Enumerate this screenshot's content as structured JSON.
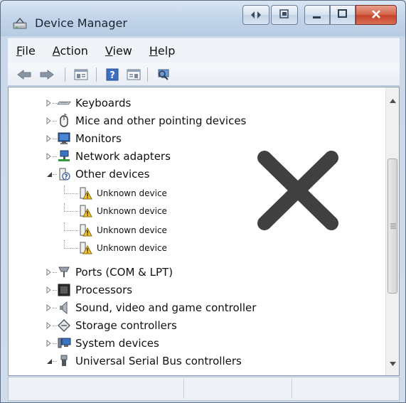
{
  "window": {
    "title": "Device Manager"
  },
  "titlebar_buttons": [
    {
      "name": "back-forward-icon"
    },
    {
      "name": "restore-window-icon"
    },
    {
      "name": "minimize-icon"
    },
    {
      "name": "maximize-icon"
    },
    {
      "name": "close-icon"
    }
  ],
  "menu": [
    {
      "accel": "F",
      "rest": "ile"
    },
    {
      "accel": "A",
      "rest": "ction"
    },
    {
      "accel": "V",
      "rest": "iew"
    },
    {
      "accel": "H",
      "rest": "elp"
    }
  ],
  "toolbar": [
    "back-icon",
    "forward-icon",
    "properties-icon",
    "help-icon",
    "update-driver-icon",
    "scan-hardware-icon"
  ],
  "tree": [
    {
      "label": "Keyboards",
      "icon": "keyboard-icon",
      "expanded": false,
      "level": 0
    },
    {
      "label": "Mice and other pointing devices",
      "icon": "mouse-icon",
      "expanded": false,
      "level": 0
    },
    {
      "label": "Monitors",
      "icon": "monitor-icon",
      "expanded": false,
      "level": 0
    },
    {
      "label": "Network adapters",
      "icon": "network-icon",
      "expanded": false,
      "level": 0
    },
    {
      "label": "Other devices",
      "icon": "unknown-device-category-icon",
      "expanded": true,
      "level": 0
    },
    {
      "label": "Unknown device",
      "icon": "unknown-device-warning-icon",
      "level": 1
    },
    {
      "label": "Unknown device",
      "icon": "unknown-device-warning-icon",
      "level": 1
    },
    {
      "label": "Unknown device",
      "icon": "unknown-device-warning-icon",
      "level": 1
    },
    {
      "label": "Unknown device",
      "icon": "unknown-device-warning-icon",
      "level": 1
    },
    {
      "label": "Ports (COM & LPT)",
      "icon": "port-icon",
      "expanded": false,
      "level": 0
    },
    {
      "label": "Processors",
      "icon": "processor-icon",
      "expanded": false,
      "level": 0
    },
    {
      "label": "Sound, video and game controller",
      "icon": "speaker-icon",
      "expanded": false,
      "level": 0
    },
    {
      "label": "Storage controllers",
      "icon": "storage-icon",
      "expanded": false,
      "level": 0
    },
    {
      "label": "System devices",
      "icon": "system-icon",
      "expanded": false,
      "level": 0
    },
    {
      "label": "Universal Serial Bus controllers",
      "icon": "usb-icon",
      "expanded": true,
      "level": 0
    }
  ],
  "overlay": {
    "icon": "cross-mark-icon",
    "color": "#404040"
  },
  "colors": {
    "close_button": "#c5432a",
    "warning": "#f2c230"
  }
}
